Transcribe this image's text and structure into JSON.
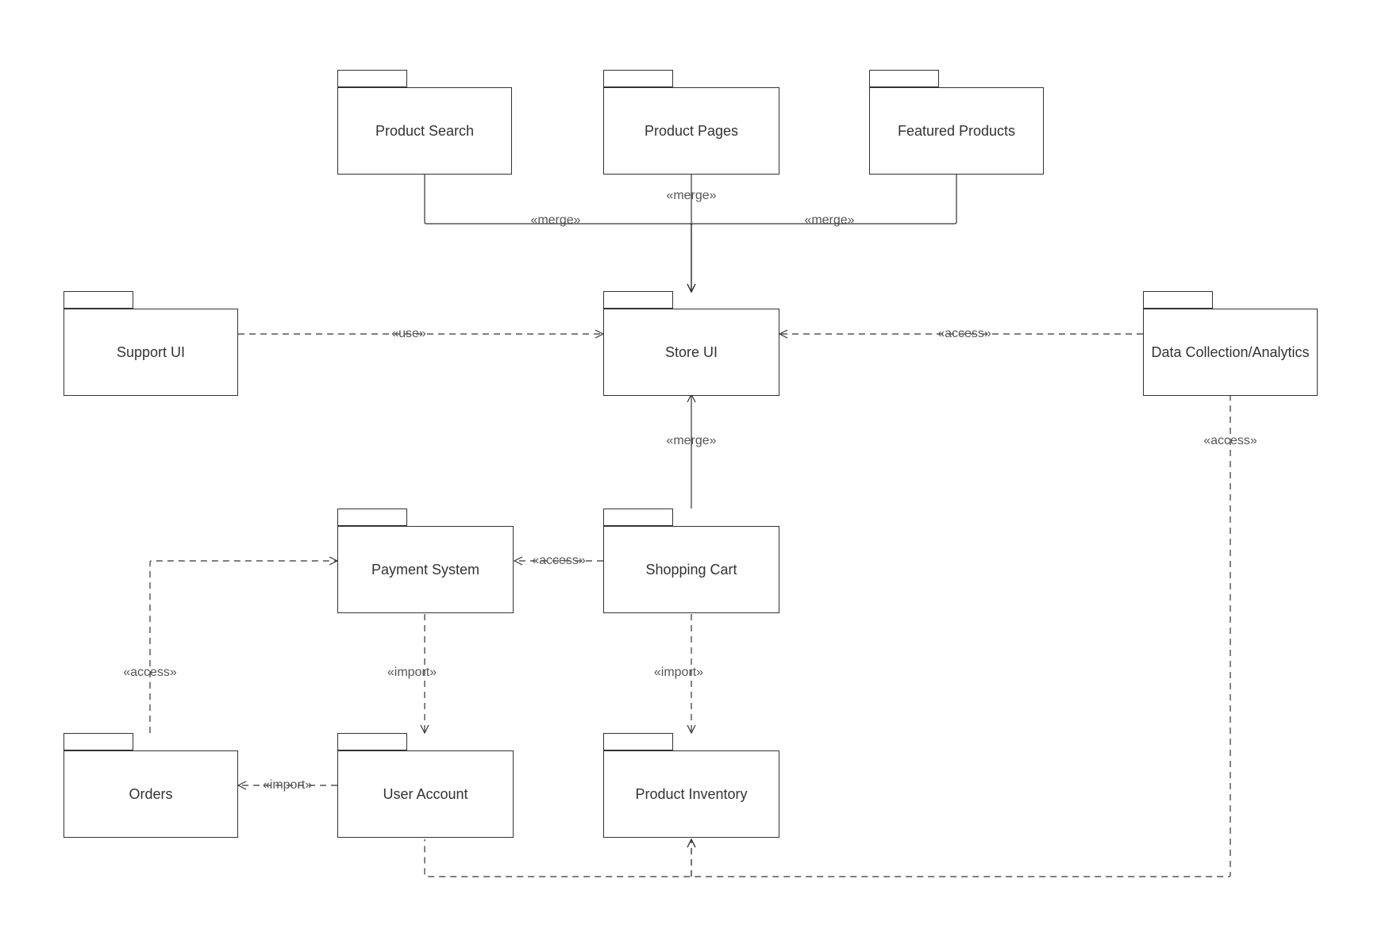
{
  "packages": {
    "product_search": {
      "label": "Product Search"
    },
    "product_pages": {
      "label": "Product Pages"
    },
    "featured_products": {
      "label": "Featured Products"
    },
    "support_ui": {
      "label": "Support UI"
    },
    "store_ui": {
      "label": "Store UI"
    },
    "data_analytics": {
      "label": "Data\nCollection/Analytics"
    },
    "payment_system": {
      "label": "Payment System"
    },
    "shopping_cart": {
      "label": "Shopping Cart"
    },
    "orders": {
      "label": "Orders"
    },
    "user_account": {
      "label": "User Account"
    },
    "product_inventory": {
      "label": "Product Inventory"
    }
  },
  "edges": {
    "ps_merge": {
      "label": "«merge»"
    },
    "pp_merge": {
      "label": "«merge»"
    },
    "fp_merge": {
      "label": "«merge»"
    },
    "support_use": {
      "label": "«use»"
    },
    "da_store": {
      "label": "«access»"
    },
    "sc_merge": {
      "label": "«merge»"
    },
    "sc_access": {
      "label": "«access»"
    },
    "pay_import": {
      "label": "«import»"
    },
    "sc_import": {
      "label": "«import»"
    },
    "ua_import": {
      "label": "«import»"
    },
    "orders_access": {
      "label": "«access»"
    },
    "da_access2": {
      "label": "«access»"
    }
  }
}
